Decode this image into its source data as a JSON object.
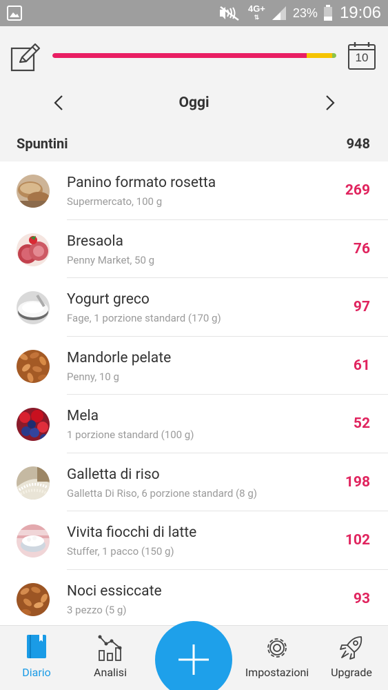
{
  "status_bar": {
    "network": "4G+",
    "battery_percent": "23%",
    "time": "19:06"
  },
  "header": {
    "calendar_day": "10",
    "day_label": "Oggi",
    "progress_fraction": 0.91
  },
  "section": {
    "title": "Spuntini",
    "total_kcal": "948"
  },
  "items": [
    {
      "name": "Panino formato rosetta",
      "desc": "Supermercato, 100 g",
      "kcal": "269",
      "thumb": "bread"
    },
    {
      "name": "Bresaola",
      "desc": "Penny Market, 50 g",
      "kcal": "76",
      "thumb": "cured-meat"
    },
    {
      "name": "Yogurt greco",
      "desc": "Fage, 1 porzione standard (170 g)",
      "kcal": "97",
      "thumb": "yogurt"
    },
    {
      "name": "Mandorle pelate",
      "desc": "Penny, 10 g",
      "kcal": "61",
      "thumb": "almonds"
    },
    {
      "name": "Mela",
      "desc": "1 porzione standard (100 g)",
      "kcal": "52",
      "thumb": "berries"
    },
    {
      "name": "Galletta di riso",
      "desc": "Galletta Di Riso, 6 porzione standard (8 g)",
      "kcal": "198",
      "thumb": "rice"
    },
    {
      "name": "Vivita fiocchi di latte",
      "desc": "Stuffer, 1 pacco (150 g)",
      "kcal": "102",
      "thumb": "cottage-cheese"
    },
    {
      "name": "Noci essiccate",
      "desc": "3 pezzo (5 g)",
      "kcal": "93",
      "thumb": "nuts"
    }
  ],
  "bottom_nav": {
    "diary": "Diario",
    "analysis": "Analisi",
    "settings": "Impostazioni",
    "upgrade": "Upgrade"
  },
  "colors": {
    "accent": "#1ea0ea",
    "calorie": "#e0245e",
    "progress": "#e91e63",
    "progress_over": "#f5c400"
  }
}
